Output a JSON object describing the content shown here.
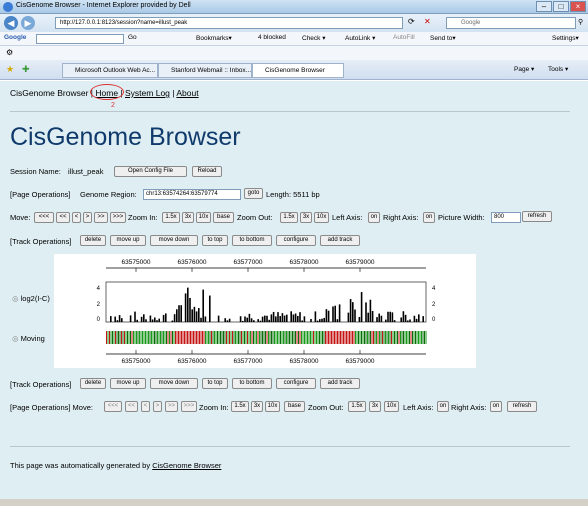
{
  "window": {
    "title": "CisGenome Browser - Internet Explorer provided by Dell"
  },
  "address": {
    "url": "http://127.0.0.1:8123/session?name=illust_peak",
    "search_placeholder": "Google"
  },
  "google_bar": {
    "brand": "Google",
    "go": "Go",
    "bookmarks": "Bookmarks▾",
    "blocked": "4 blocked",
    "check": "Check ▾",
    "autolink": "AutoLink ▾",
    "autofill": "AutoFill",
    "sendto": "Send to▾",
    "settings": "Settings▾"
  },
  "tabs": [
    {
      "label": "Microsoft Outlook Web Ac..."
    },
    {
      "label": "Stanford Webmail :: Inbox..."
    },
    {
      "label": "CisGenome Browser"
    }
  ],
  "tools": {
    "page": "Page ▾",
    "tools": "Tools ▾"
  },
  "nav": {
    "title": "CisGenome Browser",
    "home": "Home",
    "system_log": "System Log",
    "about": "About",
    "annotation_number": "2"
  },
  "page": {
    "heading": "CisGenome Browser",
    "session_label": "Session Name:",
    "session_name": "illust_peak",
    "open_config": "Open Config File",
    "reload": "Reload",
    "page_ops_label": "[Page Operations]",
    "genome_region_label": "Genome Region:",
    "region_value": "chr13:63574264:63579774",
    "goto": "goto",
    "length": "Length: 5511 bp",
    "move_label": "Move:",
    "move_buttons": [
      "<<<",
      "<<",
      "<",
      ">",
      ">>",
      ">>>"
    ],
    "zoom_in_label": "Zoom In:",
    "zoom_in": [
      "1.5x",
      "3x",
      "10x",
      "base"
    ],
    "zoom_out_label": "Zoom Out:",
    "zoom_out": [
      "1.5x",
      "3x",
      "10x"
    ],
    "left_axis_label": "Left Axis:",
    "left_axis_btn": "on",
    "right_axis_label": "Right Axis:",
    "right_axis_btn": "on",
    "picture_width_label": "Picture Width:",
    "picture_width": "800",
    "refresh": "refresh",
    "track_ops_label": "[Track Operations]",
    "track_buttons": [
      "delete",
      "move up",
      "move down",
      "to top",
      "to bottom",
      "configure",
      "add track"
    ],
    "bottom_page_ops": "[Page Operations]  Move:",
    "footer_prefix": "This page was automatically generated by",
    "footer_link": "CisGenome Browser"
  },
  "tracks": {
    "track1_label": "log2(I-C)",
    "track2_label": "Moving",
    "coords": [
      "63575000",
      "63576000",
      "63577000",
      "63578000",
      "63579000"
    ],
    "y_ticks": [
      "4",
      "2",
      "0"
    ]
  },
  "colors": {
    "content_bg": "#dfeef3",
    "title_color": "#0f3a6b",
    "bar": "#000000",
    "green": "#1a9a1a",
    "red": "#c41515"
  }
}
